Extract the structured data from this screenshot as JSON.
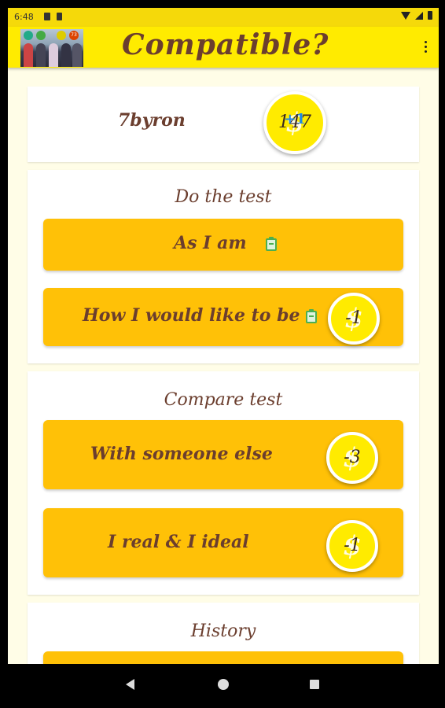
{
  "status_bar": {
    "time": "6:48"
  },
  "app_bar": {
    "title": "Compatible?",
    "logo_badges": [
      "",
      "",
      "",
      "73"
    ]
  },
  "user": {
    "name": "7byron",
    "coins": "147",
    "coin_bonus": "+1"
  },
  "do_test": {
    "title": "Do the test",
    "as_i_am": "As I am",
    "would_like": "How I would like to be",
    "would_like_cost": "-1"
  },
  "compare": {
    "title": "Compare test",
    "someone_else": "With someone else",
    "someone_else_cost": "-3",
    "real_ideal": "I real & I ideal",
    "real_ideal_cost": "-1"
  },
  "history": {
    "title": "History"
  },
  "colors": {
    "accent": "#ffeb00",
    "button": "#ffc107",
    "text": "#6b3e2e",
    "icon": "#4caf50"
  }
}
